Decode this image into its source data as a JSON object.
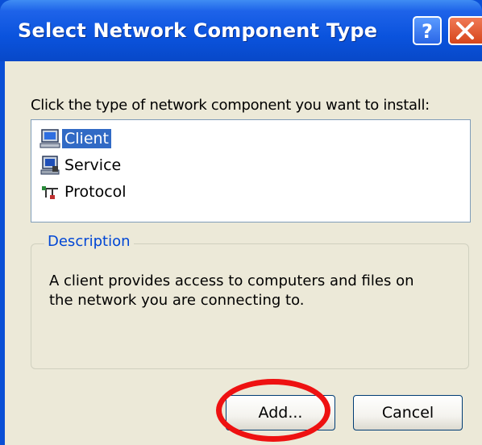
{
  "window": {
    "title": "Select Network Component Type",
    "help_symbol": "?",
    "colors": {
      "titlebar": "#0a53dd",
      "face": "#ece9d8",
      "selection": "#316ac5",
      "annotation": "#ee1111",
      "group_title": "#0046d5"
    }
  },
  "prompt": "Click the type of network component you want to install:",
  "list": {
    "items": [
      {
        "label": "Client",
        "icon": "client-computer-icon",
        "selected": true
      },
      {
        "label": "Service",
        "icon": "service-computer-icon",
        "selected": false
      },
      {
        "label": "Protocol",
        "icon": "protocol-icon",
        "selected": false
      }
    ]
  },
  "description": {
    "title": "Description",
    "text": "A client provides access to computers and files on the network you are connecting to."
  },
  "buttons": {
    "add": "Add...",
    "cancel": "Cancel"
  }
}
